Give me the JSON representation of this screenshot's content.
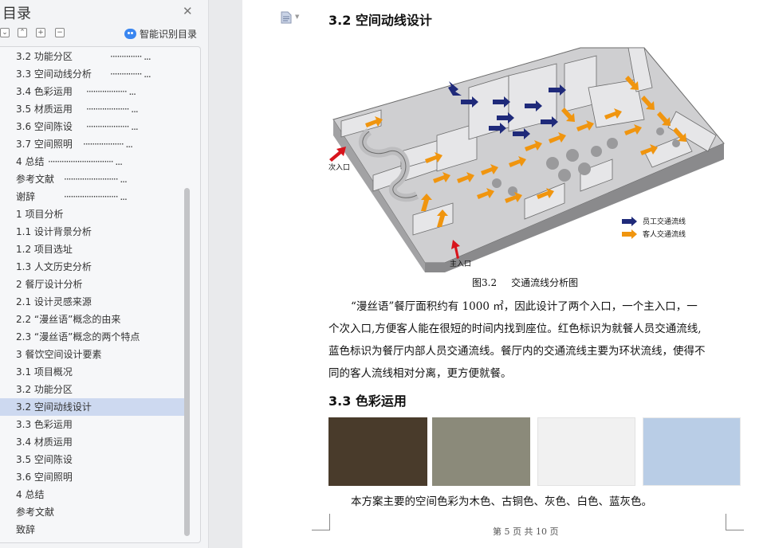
{
  "sidebar": {
    "title": "目录",
    "smart_label": "智能识别目录",
    "toc": [
      {
        "label": "3.2  功能分区",
        "dots": true
      },
      {
        "label": "3.3  空间动线分析",
        "dots": true
      },
      {
        "label": "3.4  色彩运用",
        "dots": true
      },
      {
        "label": "3.5  材质运用",
        "dots": true
      },
      {
        "label": "3.6 空间陈设",
        "dots": true
      },
      {
        "label": "3.7 空间照明",
        "dots": true
      },
      {
        "label": "4 总结",
        "dots": true
      },
      {
        "label": "参考文献",
        "dots": true
      },
      {
        "label": "谢辞",
        "dots": true
      },
      {
        "label": "1 项目分析"
      },
      {
        "label": "1.1 设计背景分析"
      },
      {
        "label": "1.2 项目选址"
      },
      {
        "label": "1.3 人文历史分析"
      },
      {
        "label": "2 餐厅设计分析"
      },
      {
        "label": "2.1 设计灵感来源"
      },
      {
        "label": "2.2 “漫丝语”概念的由来"
      },
      {
        "label": "2.3 “漫丝语”概念的两个特点"
      },
      {
        "label": "3 餐饮空间设计要素"
      },
      {
        "label": "3.1 项目概况"
      },
      {
        "label": "3.2 功能分区"
      },
      {
        "label": "3.2 空间动线设计",
        "active": true
      },
      {
        "label": "3.3 色彩运用"
      },
      {
        "label": "3.4 材质运用"
      },
      {
        "label": "3.5 空间陈设"
      },
      {
        "label": "3.6 空间照明"
      },
      {
        "label": "4 总结"
      },
      {
        "label": "参考文献"
      },
      {
        "label": "致辞"
      }
    ]
  },
  "doc": {
    "heading1": "3.2 空间动线设计",
    "figure": {
      "label_secondary_entrance": "次入口",
      "label_main_entrance": "主入口",
      "legend_staff": "员工交通流线",
      "legend_guest": "客人交通流线",
      "caption_num": "图3.2",
      "caption_text": "交通流线分析图"
    },
    "para1": [
      "“漫丝语”餐厅面积约有 1000 ㎡，因此设计了两个入口，一个主入口，一",
      "个次入口,方便客人能在很短的时间内找到座位。红色标识为就餐人员交通流线,",
      "蓝色标识为餐厅内部人员交通流线。餐厅内的交通流线主要为环状流线，使得不",
      "同的客人流线相对分离，更方便就餐。"
    ],
    "heading2": "3.3 色彩运用",
    "swatches": [
      "#493b2b",
      "#8b8a7a",
      "#f1f1f1",
      "#b9cde6"
    ],
    "para2": "本方案主要的空间色彩为木色、古铜色、灰色、白色、蓝灰色。",
    "footer": "第 5 页 共 10 页"
  },
  "colors": {
    "staff_arrow": "#1f2a7a",
    "guest_arrow": "#f0950f",
    "entrance_arrow": "#d8141c",
    "active_toc": "#cdd9f0"
  }
}
